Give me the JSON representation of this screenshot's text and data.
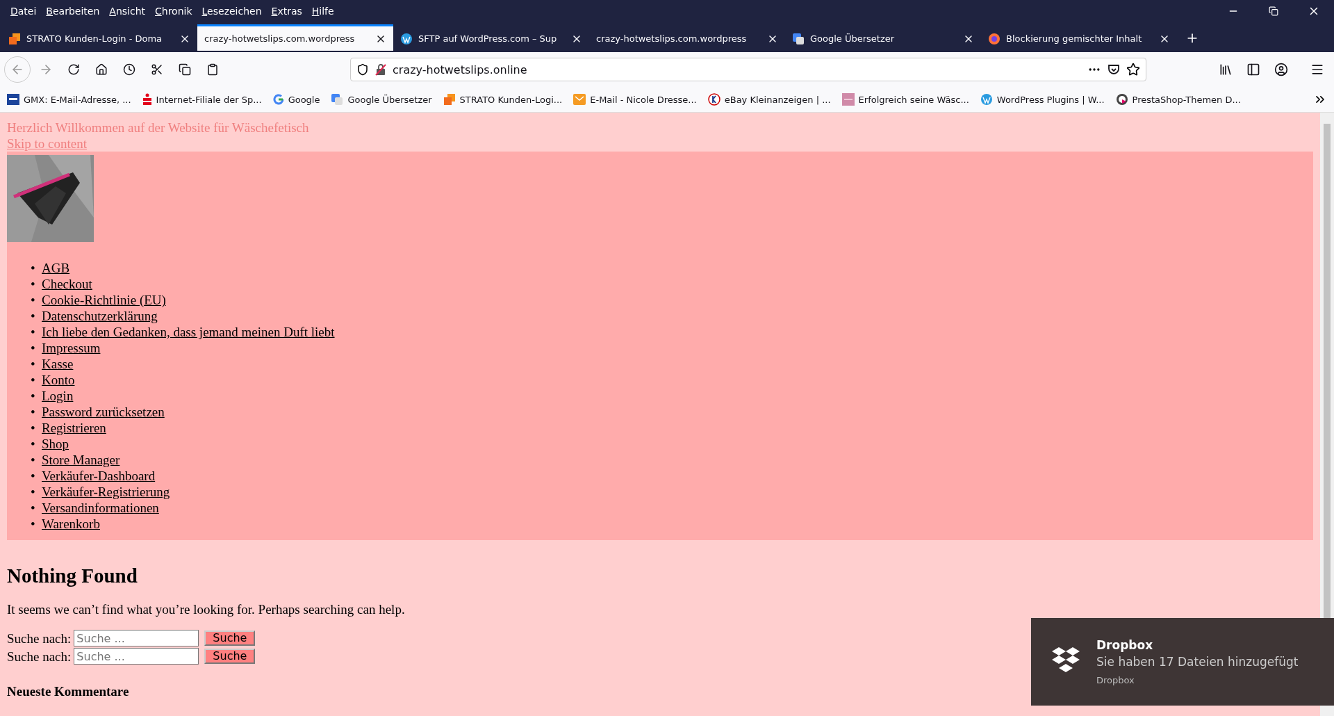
{
  "menu": [
    "Datei",
    "Bearbeiten",
    "Ansicht",
    "Chronik",
    "Lesezeichen",
    "Extras",
    "Hilfe"
  ],
  "tabs": [
    {
      "title": "STRATO Kunden-Login - Doma",
      "selected": false
    },
    {
      "title": "crazy-hotwetslips.com.wordpress",
      "selected": true
    },
    {
      "title": "SFTP auf WordPress.com – Sup",
      "selected": false
    },
    {
      "title": "crazy-hotwetslips.com.wordpress",
      "selected": false
    },
    {
      "title": "Google Übersetzer",
      "selected": false
    },
    {
      "title": "Blockierung gemischter Inhalt",
      "selected": false
    }
  ],
  "address": {
    "url": "crazy-hotwetslips.online"
  },
  "bookmarks": [
    "GMX: E-Mail-Adresse, ...",
    "Internet-Filiale der Sp...",
    "Google",
    "Google Übersetzer",
    "STRATO Kunden-Logi...",
    "E-Mail - Nicole Dresse...",
    "eBay Kleinanzeigen | ...",
    "Erfolgreich seine Wäsc...",
    "WordPress Plugins | W...",
    "PrestaShop-Themen D..."
  ],
  "page": {
    "tagline": "Herzlich Willkommen auf der Website für Wäschefetisch",
    "skip_link": "Skip to content",
    "bullet": "•",
    "nav": [
      "AGB",
      "Checkout",
      "Cookie-Richtlinie (EU)",
      "Datenschutzerklärung",
      "Ich liebe den Gedanken, dass jemand meinen Duft liebt",
      "Impressum",
      "Kasse",
      "Konto",
      "Login",
      "Password zurücksetzen",
      "Registrieren",
      "Shop",
      "Store Manager",
      "Verkäufer-Dashboard",
      "Verkäufer-Registrierung",
      "Versandinformationen",
      "Warenkorb"
    ],
    "heading": "Nothing Found",
    "message": "It seems we can’t find what you’re looking for. Perhaps searching can help.",
    "searches": [
      {
        "label": "Suche nach:",
        "placeholder": "Suche ...",
        "button": "Suche"
      },
      {
        "label": "Suche nach:",
        "placeholder": "Suche ...",
        "button": "Suche"
      }
    ],
    "widget_title": "Neueste Kommentare"
  },
  "notification": {
    "title": "Dropbox",
    "message": "Sie haben 17 Dateien hinzugefügt",
    "source": "Dropbox"
  }
}
